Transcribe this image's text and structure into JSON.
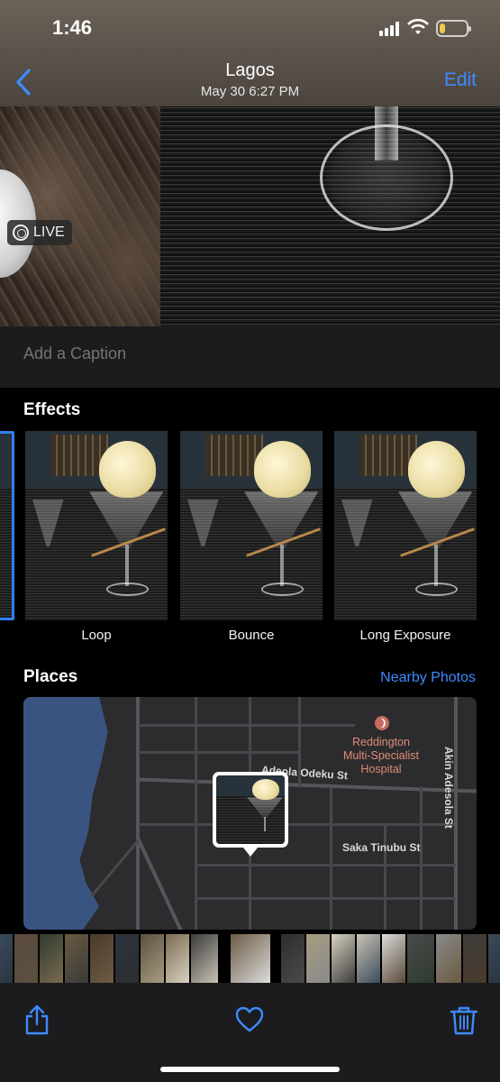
{
  "status_bar": {
    "time": "1:46",
    "battery_level": 0.2
  },
  "nav": {
    "back_icon": "chevron-left-icon",
    "title": "Lagos",
    "subtitle": "May 30  6:27 PM",
    "edit_label": "Edit",
    "accent_color": "#3d8bff"
  },
  "photo": {
    "live_label": "LIVE"
  },
  "caption": {
    "placeholder": "Add a Caption"
  },
  "effects": {
    "title": "Effects",
    "items": [
      {
        "label": "Loop"
      },
      {
        "label": "Bounce"
      },
      {
        "label": "Long Exposure"
      }
    ]
  },
  "places": {
    "title": "Places",
    "nearby_label": "Nearby Photos",
    "map": {
      "street_1": "Adeola Odeku St",
      "street_2": "Saka Tinubu St",
      "street_3": "Akin Adesola St",
      "poi": "Reddington Multi-Specialist Hospital"
    }
  },
  "toolbar": {
    "share_icon": "share-icon",
    "favorite_icon": "heart-icon",
    "delete_icon": "trash-icon"
  }
}
